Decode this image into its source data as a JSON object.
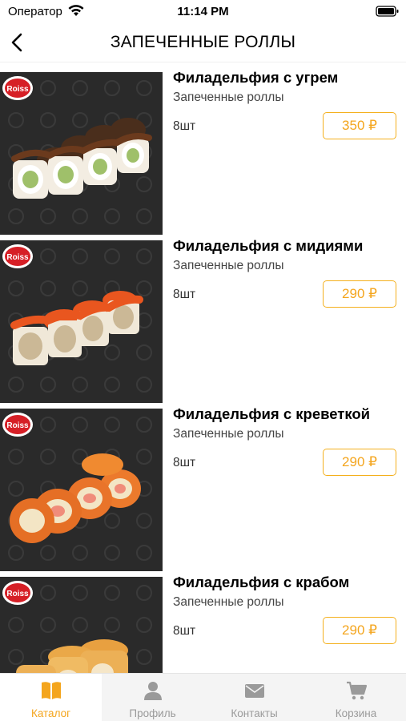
{
  "status_bar": {
    "carrier": "Оператор",
    "time": "11:14 PM"
  },
  "nav": {
    "title": "ЗАПЕЧЕННЫЕ РОЛЛЫ"
  },
  "brand": {
    "logo_text": "Roiss"
  },
  "colors": {
    "accent": "#f4a51d",
    "tab_inactive": "#9a9a9a",
    "image_bg": "#2a2a2a"
  },
  "products": [
    {
      "name": "Филадельфия с угрем",
      "category": "Запеченные роллы",
      "qty": "8шт",
      "price": "350 ₽",
      "image_icon": "sushi-eel-roll-image"
    },
    {
      "name": "Филадельфия с мидиями",
      "category": "Запеченные роллы",
      "qty": "8шт",
      "price": "290 ₽",
      "image_icon": "sushi-mussel-roll-image"
    },
    {
      "name": "Филадельфия с креветкой",
      "category": "Запеченные роллы",
      "qty": "8шт",
      "price": "290 ₽",
      "image_icon": "sushi-shrimp-roll-image"
    },
    {
      "name": "Филадельфия с крабом",
      "category": "Запеченные роллы",
      "qty": "8шт",
      "price": "290 ₽",
      "image_icon": "sushi-crab-roll-image"
    }
  ],
  "tabs": [
    {
      "label": "Каталог",
      "icon": "book-icon",
      "active": true
    },
    {
      "label": "Профиль",
      "icon": "person-icon",
      "active": false
    },
    {
      "label": "Контакты",
      "icon": "envelope-icon",
      "active": false
    },
    {
      "label": "Корзина",
      "icon": "cart-icon",
      "active": false
    }
  ]
}
